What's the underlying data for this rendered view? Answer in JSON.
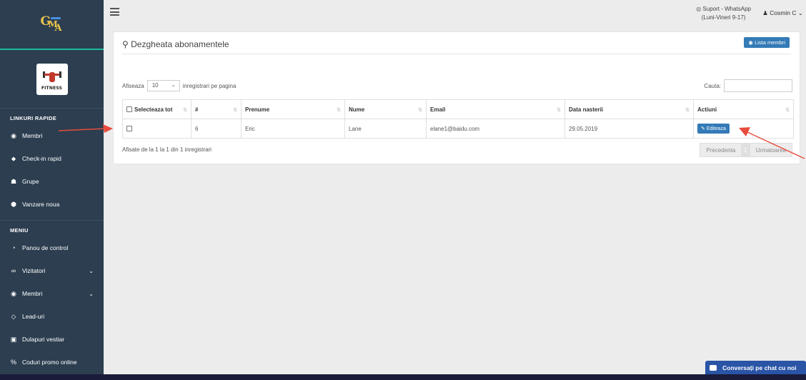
{
  "sidebar": {
    "logo_letters": [
      "G",
      "M",
      "A"
    ],
    "brand_text": "FITNESS",
    "quick_links_title": "LINKURI RAPIDE",
    "quick_links": [
      {
        "label": "Membri",
        "icon": "user-circle-icon"
      },
      {
        "label": "Check-in rapid",
        "icon": "map-marker-icon"
      },
      {
        "label": "Grupe",
        "icon": "users-icon"
      },
      {
        "label": "Vanzare noua",
        "icon": "cube-icon"
      }
    ],
    "menu_title": "MENIU",
    "menu": [
      {
        "label": "Panou de control",
        "icon": "dashboard-icon"
      },
      {
        "label": "Vizitatori",
        "icon": "glasses-icon"
      },
      {
        "label": "Membri",
        "icon": "user-circle-icon"
      },
      {
        "label": "Lead-uri",
        "icon": "diamond-icon"
      },
      {
        "label": "Dulapuri vestiar",
        "icon": "lock-icon"
      },
      {
        "label": "Coduri promo online",
        "icon": "percent-icon"
      }
    ]
  },
  "topbar": {
    "support_line1": "Suport - WhatsApp",
    "support_line2": "(Luni-Vineri 9-17)",
    "user_name": "Cosmin C"
  },
  "card": {
    "title": "Dezgheata abonamentele",
    "members_button": "Lista membri",
    "show_label": "Afiseaza",
    "page_size": "10",
    "per_page_label": "inregistrari pe pagina",
    "search_label": "Cauta:",
    "columns": [
      "Selecteaza tot",
      "#",
      "Prenume",
      "Nume",
      "Email",
      "Data nasterii",
      "Actiuni"
    ],
    "rows": [
      {
        "id": "6",
        "first_name": "Eric",
        "last_name": "Lane",
        "email": "elane1@baidu.com",
        "birth_date": "29.05.2019",
        "action": "Editeaza"
      }
    ],
    "info": "Afisate de la 1 la 1 din 1 inregistrari",
    "prev": "Precedenta",
    "current_page": "1",
    "next": "Urmatoarea"
  },
  "chat": {
    "label": "Conversați pe chat cu noi"
  },
  "colors": {
    "sidebar": "#2c3e50",
    "accent": "#337ab7",
    "annotation": "#e74c3c"
  }
}
